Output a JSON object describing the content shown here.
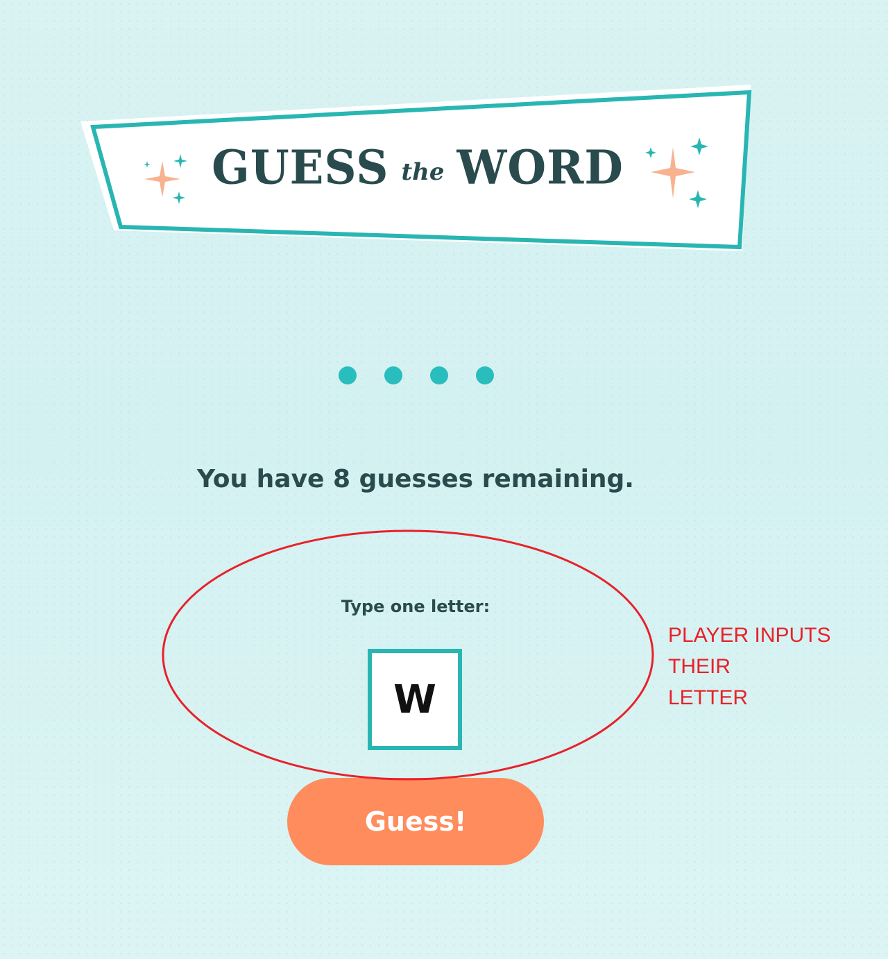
{
  "banner": {
    "title_left": "GUESS",
    "title_middle": "the",
    "title_right": "WORD"
  },
  "word": {
    "hidden_letters": [
      "●",
      "●",
      "●",
      "●"
    ]
  },
  "status": {
    "remaining_text": "You have 8 guesses remaining."
  },
  "input": {
    "label": "Type one letter:",
    "value": "W"
  },
  "button": {
    "label": "Guess!"
  },
  "annotation": {
    "lines": [
      "PLAYER INPUTS",
      "THEIR",
      "LETTER"
    ]
  },
  "colors": {
    "teal": "#29b6b3",
    "dark_text": "#2a4b4d",
    "button": "#ff8c5d",
    "sparkle_peach": "#f7b28f",
    "annotation_red": "#e8212a"
  },
  "icons": [
    "sparkle-icon-left",
    "sparkle-icon-right"
  ]
}
